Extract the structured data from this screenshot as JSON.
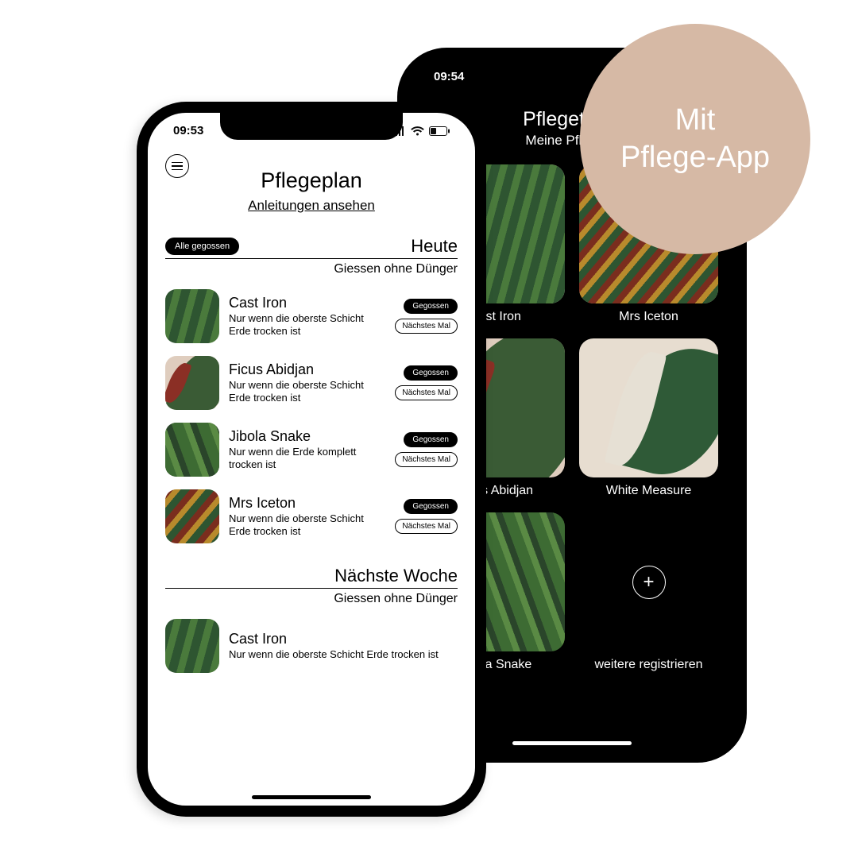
{
  "badge": {
    "line1": "Mit",
    "line2": "Pflege-App"
  },
  "frontPhone": {
    "time": "09:53",
    "title": "Pflegeplan",
    "subtitle": "Anleitungen ansehen",
    "sections": [
      {
        "pill": "Alle gegossen",
        "label": "Heute",
        "sub": "Giessen ohne Dünger",
        "plants": [
          {
            "name": "Cast Iron",
            "note": "Nur wenn die oberste Schicht Erde trocken ist",
            "solid": "Gegossen",
            "outline": "Nächstes Mal",
            "img": "castiron"
          },
          {
            "name": "Ficus Abidjan",
            "note": "Nur wenn die oberste Schicht Erde trocken ist",
            "solid": "Gegossen",
            "outline": "Nächstes Mal",
            "img": "ficus"
          },
          {
            "name": "Jibola Snake",
            "note": "Nur wenn die Erde komplett trocken ist",
            "solid": "Gegossen",
            "outline": "Nächstes Mal",
            "img": "snake"
          },
          {
            "name": "Mrs Iceton",
            "note": "Nur wenn die oberste Schicht Erde trocken ist",
            "solid": "Gegossen",
            "outline": "Nächstes Mal",
            "img": "iceton"
          }
        ]
      },
      {
        "pill": null,
        "label": "Nächste Woche",
        "sub": "Giessen ohne Dünger",
        "plants": [
          {
            "name": "Cast Iron",
            "note": "Nur wenn die oberste Schicht Erde trocken ist",
            "solid": null,
            "outline": null,
            "img": "castiron"
          }
        ]
      }
    ]
  },
  "backPhone": {
    "time": "09:54",
    "title": "Pflegetipps",
    "subtitle": "Meine Pflanzen",
    "tiles": [
      {
        "label": "Cast Iron",
        "img": "castiron"
      },
      {
        "label": "Mrs Iceton",
        "img": "iceton"
      },
      {
        "label": "Ficus Abidjan",
        "img": "ficus"
      },
      {
        "label": "White Measure",
        "img": "white"
      },
      {
        "label": "Jibola Snake",
        "img": "snake"
      }
    ],
    "addLabel": "weitere registrieren"
  }
}
